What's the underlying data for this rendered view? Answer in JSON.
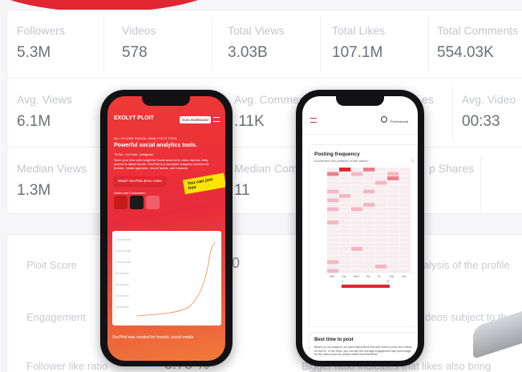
{
  "stats_top": [
    {
      "label": "Followers",
      "value": "5.3M"
    },
    {
      "label": "Videos",
      "value": "578"
    },
    {
      "label": "Total Views",
      "value": "3.03B"
    },
    {
      "label": "Total Likes",
      "value": "107.1M"
    },
    {
      "label": "Total Comments",
      "value": "554.03K"
    }
  ],
  "stats_mid": [
    {
      "label": "Avg. Views",
      "value": "6.1M"
    },
    {
      "label": "Avg. Comments",
      "value": ".11K"
    },
    {
      "label": "es",
      "value": ""
    },
    {
      "label": "Avg. Video",
      "value": "00:33"
    }
  ],
  "stats_bot": [
    {
      "label": "Median Views",
      "value": "1.3M"
    },
    {
      "label": "Median Comm",
      "value": "11"
    },
    {
      "label": "p Shares",
      "value": ""
    }
  ],
  "ploit": {
    "score_label": "Ploit Score",
    "score_value": "0",
    "engagement_label": "Engagement",
    "follower_like_label": "Follower like ratio",
    "follower_like_value": "3.78 %",
    "analysis_text": "alysis of the profile",
    "videos_text": "deos subject to th",
    "bigger_text": "Bigger ratio indicates that likes also bring"
  },
  "phone1": {
    "logo": "EXOLYT PLOIT",
    "dashboard_btn": "Goto Dashboard",
    "tagline": "ALL-IN-ONE SOCIAL ANALYTICS TOOL",
    "headline": "Powerful social analytics tools.",
    "platforms": "TikTok, YouTube, Instagram",
    "description": "Save your time with insightful Social account & video reports, easy access to latest trends. SocPloit is a complete analytics solution for brands, media agencies, record labels, and creators.",
    "demo_btn": "Watch SocPloit demo video",
    "join_badge": "You can join free",
    "seen_text": "Users and Customers:",
    "y_ticks": [
      "1,000,000,000",
      "1,000,000,000",
      "1,000,000,000",
      "800,000,000",
      "600,000,000",
      "400,000,000",
      "200,000,000",
      "0"
    ],
    "bottom_text": "SocPloit was created for brands, social media"
  },
  "phone2": {
    "profile": "Professional",
    "posting_title": "Posting frequency",
    "posting_question": "At what time user publishes of their videos?",
    "best_title": "Best time to post",
    "best_desc": "Based on our analysis, we have listed below the best times to post new videos for this ID. In the chart, you can see the average engagement rate percentage for the videos that are posted within that timeframe.",
    "days": [
      "Mon",
      "Tue",
      "Wed",
      "Thu",
      "Fri",
      "Sat",
      "Sun"
    ],
    "scale_min": "0",
    "scale_max": "20"
  },
  "colors": {
    "brand_red": "#e0262f",
    "text_label": "#c4c6cc",
    "text_value": "#6c6f78"
  }
}
